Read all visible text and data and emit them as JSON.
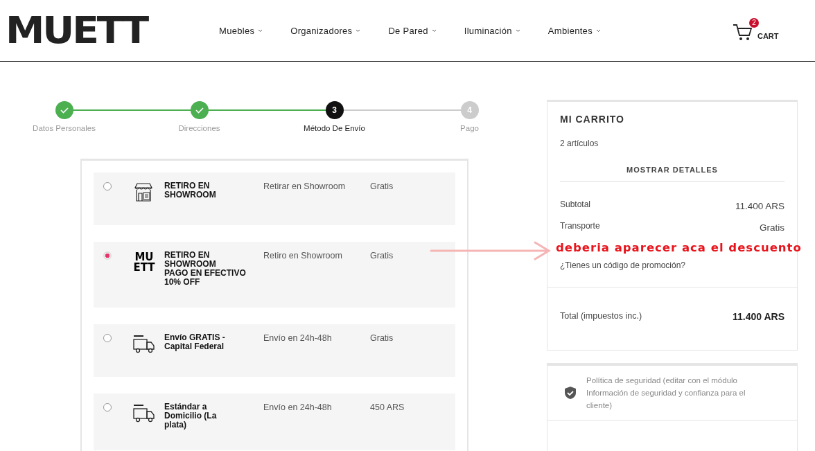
{
  "header": {
    "logo": "MUETT",
    "nav": [
      {
        "label": "Muebles"
      },
      {
        "label": "Organizadores"
      },
      {
        "label": "De Pared"
      },
      {
        "label": "Iluminación"
      },
      {
        "label": "Ambientes"
      }
    ],
    "cart": {
      "count": "2",
      "label": "CART"
    }
  },
  "steps": [
    {
      "label": "Datos Personales",
      "completed": true,
      "selected": false
    },
    {
      "label": "Direcciones",
      "completed": true,
      "selected": false
    },
    {
      "label": "Método De Envío",
      "completed": false,
      "selected": true,
      "number": "3"
    },
    {
      "label": "Pago",
      "completed": false,
      "selected": false,
      "number": "4"
    }
  ],
  "shipping_options": [
    {
      "selected": false,
      "icon": {
        "kind": "store"
      },
      "name": "RETIRO EN\nSHOWROOM",
      "description": "Retirar en Showroom",
      "price": "Gratis"
    },
    {
      "selected": true,
      "icon": {
        "kind": "logo",
        "lines": [
          "MU",
          "ETT"
        ]
      },
      "name": "RETIRO EN\nSHOWROOM\nPAGO EN EFECTIVO\n10% OFF",
      "description": "Retiro en Showroom",
      "price": "Gratis"
    },
    {
      "selected": false,
      "icon": {
        "kind": "truck"
      },
      "name": "Envío GRATIS -\nCapital Federal",
      "description": "Envío en 24h-48h",
      "price": "Gratis"
    },
    {
      "selected": false,
      "icon": {
        "kind": "truck"
      },
      "name": "Estándar a\nDomicilio (La\nplata)",
      "description": "Envío en 24h-48h",
      "price": "450 ARS"
    }
  ],
  "cart_summary": {
    "title": "MI CARRITO",
    "items_count": "2 artículos",
    "details_button": "MOSTRAR DETALLES",
    "lines": [
      {
        "label": "Subtotal",
        "value": "11.400 ARS"
      },
      {
        "label": "Transporte",
        "value": "Gratis"
      }
    ],
    "promo_link": "¿Tienes un código de promoción?",
    "total_label": "Total (impuestos inc.)",
    "total_value": "11.400 ARS"
  },
  "reassurance": [
    {
      "text": "Política de seguridad (editar con el módulo Información de seguridad y confianza para el cliente)"
    }
  ],
  "annotation": {
    "text": "deberia aparecer aca el descuento"
  }
}
